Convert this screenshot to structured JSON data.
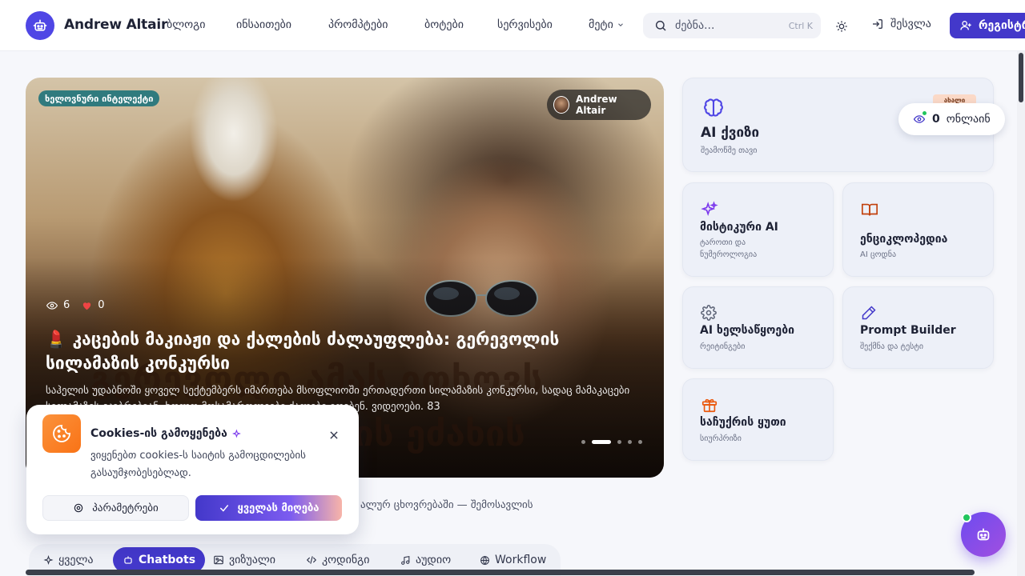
{
  "header": {
    "brand": "Andrew Altair",
    "nav": [
      "ბლოგი",
      "ინსაითები",
      "პრომპტები",
      "ბოტები",
      "სერვისები"
    ],
    "more_label": "მეტი",
    "search_placeholder": "ძებნა...",
    "search_shortcut": "Ctrl K",
    "login_label": "შესვლა",
    "register_label": "რეგისტრაცია"
  },
  "hero": {
    "category": "ხელოვნური ინტელექტი",
    "author": "Andrew Altair",
    "views": "6",
    "likes": "0",
    "title": "💄 კაცების მაკიაჟი და ქალების ძალაუფლება: გერევოლის სილამაზის კონკურსი",
    "description": "საჰელის უდაბნოში ყოველ სექტემბერს იმართება მსოფლიოში ერთადერთი სილამაზის კონკურსი, სადაც მამაკაცები სილამაზეს ეჯიბრებიან, ხოლო მოსამართლეები ქალები იღებენ. ვიდეოები. 83",
    "bg_text_1": "გერევოლი ამას ითხოვს",
    "bg_text_2": "ის ეძახის",
    "dots_total": 5,
    "dot_active": 2
  },
  "below_text": "ალურ ცხოვრებაში — შემოსავლის",
  "categories": {
    "items": [
      {
        "label": "ყველა",
        "icon": "sparkle-icon"
      },
      {
        "label": "Chatbots",
        "icon": "robot-icon"
      },
      {
        "label": "ვიზუალი",
        "icon": "image-icon"
      },
      {
        "label": "კოდინგი",
        "icon": "code-icon"
      },
      {
        "label": "აუდიო",
        "icon": "music-icon"
      },
      {
        "label": "Workflow",
        "icon": "globe-icon"
      }
    ],
    "active_index": 1
  },
  "sidebar_cards": {
    "quiz": {
      "title": "AI ქვიზი",
      "subtitle": "შეამოწმე თავი",
      "badge": "ახალი",
      "icon": "brain-icon"
    },
    "mystic": {
      "title": "მისტიკური AI",
      "subtitle": "ტაროთი და ნუმეროლოგია",
      "icon": "sparkles-icon"
    },
    "encyclopedia": {
      "title": "ენციკლოპედია",
      "subtitle": "AI ცოდნა",
      "icon": "book-icon"
    },
    "tools": {
      "title": "AI ხელსაწყოები",
      "subtitle": "რეიტინგები",
      "icon": "gear-icon"
    },
    "prompt_builder": {
      "title": "Prompt Builder",
      "subtitle": "შექმნა და ტესტი",
      "icon": "pencil-icon"
    },
    "gift": {
      "title": "საჩუქრის ყუთი",
      "subtitle": "სიურპრიზი",
      "icon": "gift-icon"
    }
  },
  "online": {
    "count": "0",
    "label": "ონლაინ"
  },
  "cookie": {
    "title": "Cookies-ის გამოყენება",
    "text": "ვიყენებთ cookies-ს საიტის გამოცდილების გასაუმჯობესებლად.",
    "settings_label": "პარამეტრები",
    "accept_label": "ყველას მიღება"
  },
  "colors": {
    "accent": "#4338ca",
    "quiz_icon": "#4f46e5",
    "mystic_icon": "#7c3aed",
    "book_icon": "#c2410c",
    "gift_icon": "#ea580c",
    "online": "#22c55e",
    "cookie": "#f97316"
  }
}
